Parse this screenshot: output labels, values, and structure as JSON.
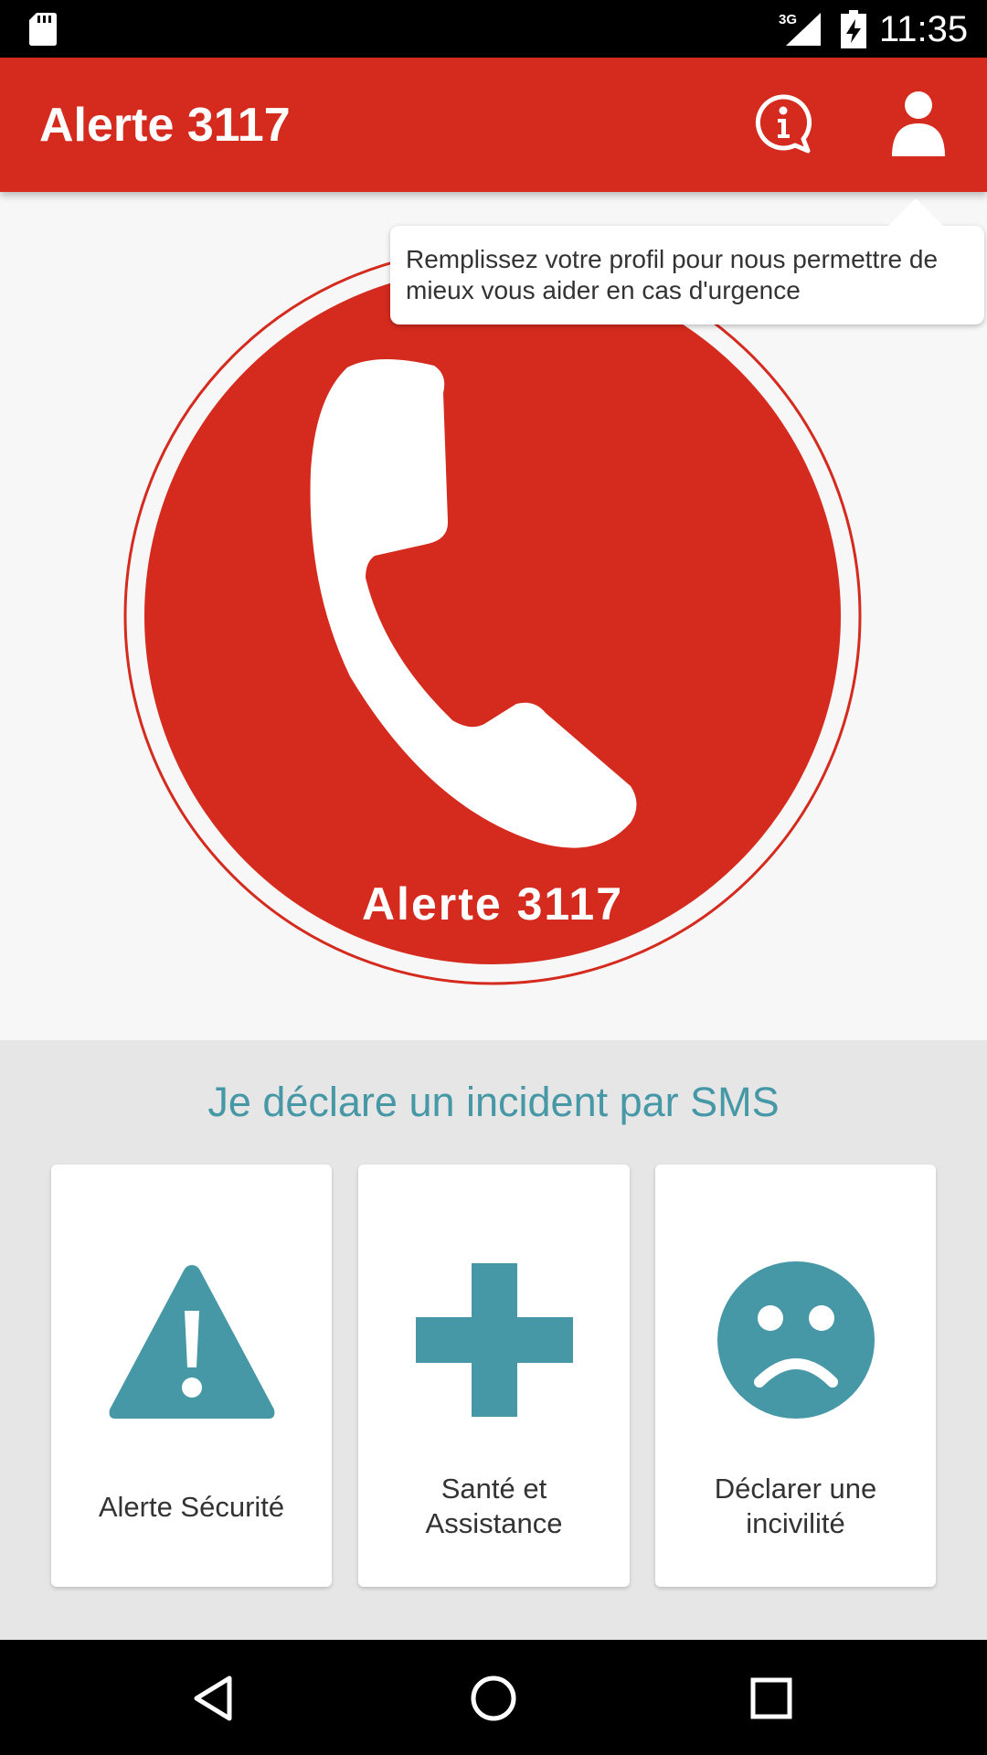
{
  "status_bar": {
    "time": "11:35",
    "network": "3G",
    "icons": [
      "sd-card-icon",
      "signal-icon",
      "battery-charging-icon"
    ]
  },
  "app_bar": {
    "title": "Alerte 3117",
    "actions": [
      {
        "icon": "info-bubble-icon"
      },
      {
        "icon": "person-icon"
      }
    ]
  },
  "tooltip": {
    "text": "Remplissez votre profil pour nous permettre de mieux vous aider en cas d'urgence"
  },
  "call_button": {
    "label": "Alerte 3117",
    "icon": "phone-icon",
    "color": "#d52a1e"
  },
  "sms_section": {
    "title": "Je déclare un incident par SMS",
    "accent_color": "#4698a6",
    "cards": [
      {
        "label": "Alerte Sécurité",
        "icon": "warning-triangle-icon"
      },
      {
        "label_line1": "Santé et",
        "label_line2": "Assistance",
        "icon": "medical-cross-icon"
      },
      {
        "label_line1": "Déclarer une",
        "label_line2": "incivilité",
        "icon": "sad-face-icon"
      }
    ]
  },
  "nav_bar": {
    "icons": [
      "back-icon",
      "home-icon",
      "recents-icon"
    ]
  }
}
